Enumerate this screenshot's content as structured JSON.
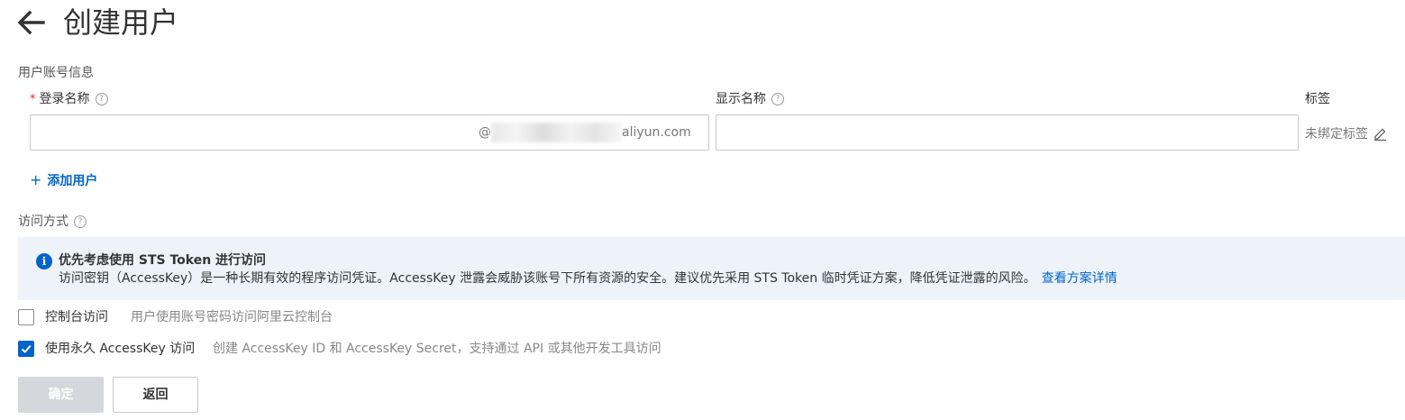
{
  "header": {
    "title": "创建用户"
  },
  "account_section": {
    "label": "用户账号信息",
    "login_name": {
      "label": "登录名称",
      "required_mark": "*",
      "value": "",
      "suffix_prefix": "@",
      "suffix_domain": "aliyun.com"
    },
    "display_name": {
      "label": "显示名称",
      "value": ""
    },
    "tags": {
      "label": "标签",
      "value": "未绑定标签"
    },
    "add_user": "添加用户"
  },
  "access_section": {
    "label": "访问方式",
    "alert": {
      "title": "优先考虑使用 STS Token 进行访问",
      "description": "访问密钥（AccessKey）是一种长期有效的程序访问凭证。AccessKey 泄露会威胁该账号下所有资源的安全。建议优先采用 STS Token 临时凭证方案，降低凭证泄露的风险。",
      "link": "查看方案详情"
    },
    "options": [
      {
        "label": "控制台访问",
        "description": "用户使用账号密码访问阿里云控制台",
        "checked": false
      },
      {
        "label": "使用永久 AccessKey 访问",
        "description": "创建 AccessKey ID 和 AccessKey Secret，支持通过 API 或其他开发工具访问",
        "checked": true
      }
    ]
  },
  "footer": {
    "confirm": "确定",
    "back": "返回"
  },
  "colors": {
    "accent": "#0064c8",
    "required": "#d93026",
    "alert_bg": "#eef3fa",
    "disabled_button": "#d4d7db"
  }
}
